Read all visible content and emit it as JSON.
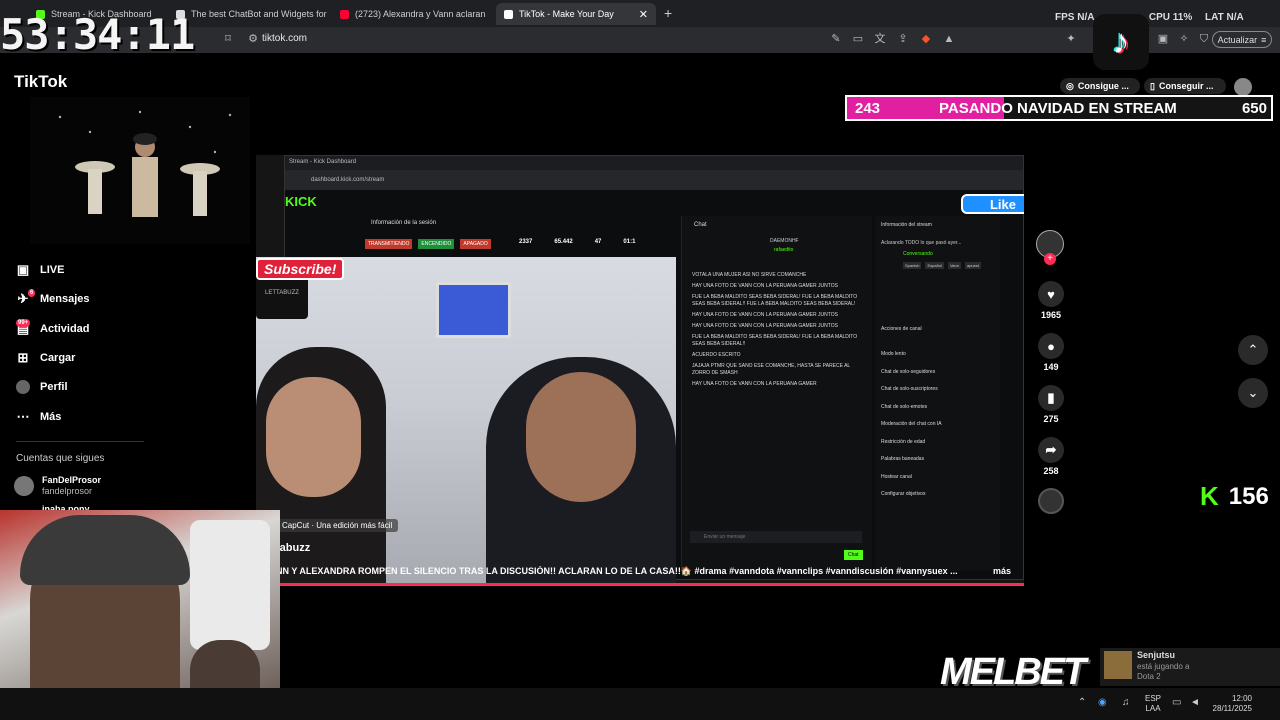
{
  "clock": "53:34:11",
  "tabs": [
    {
      "title": "Stream - Kick Dashboard",
      "color": "#53fc18"
    },
    {
      "title": "The best ChatBot and Widgets for Ki",
      "color": "#dddddd"
    },
    {
      "title": "(2723) Alexandra y Vann aclaran",
      "color": "#ff0033"
    },
    {
      "title": "TikTok - Make Your Day",
      "color": "#ffffff"
    }
  ],
  "address": {
    "url": "tiktok.com",
    "update_label": "Actualizar"
  },
  "system_stats": {
    "fps_label": "FPS",
    "fps_value": "N/A",
    "cpu_label": "CPU",
    "cpu_value": "11%",
    "lat_label": "LAT",
    "lat_value": "N/A"
  },
  "tiktok": {
    "logo": "TikTok",
    "nav": [
      {
        "label": "LIVE",
        "icon": "live-icon"
      },
      {
        "label": "Mensajes",
        "icon": "messages-icon",
        "badge": "6"
      },
      {
        "label": "Actividad",
        "icon": "activity-icon",
        "badge": "99+"
      },
      {
        "label": "Cargar",
        "icon": "upload-icon"
      },
      {
        "label": "Perfil",
        "icon": "profile-icon"
      },
      {
        "label": "Más",
        "icon": "more-icon"
      }
    ],
    "following_title": "Cuentas que sigues",
    "following": [
      {
        "name": "FanDelProsor",
        "handle": "fandelprosor"
      },
      {
        "name": "inaba.pony",
        "handle": ""
      }
    ],
    "header_buttons": [
      "Consigue ...",
      "Conseguir ..."
    ]
  },
  "video": {
    "capcut_label": "CapCut · Una edición más fácil",
    "author": "tabuzz",
    "caption": "NN Y ALEXANDRA ROMPEN EL SILENCIO TRAS LA DISCUSIÓN!! ACLARAN LO DE LA CASA!!🏠 #drama #vanndota #vannclips #vanndiscusión #vannysuex ...",
    "more": "más",
    "subscribe": "Subscribe!",
    "like": "Like",
    "streamer_tag": "LETTABUZZ"
  },
  "actions": {
    "likes": "1965",
    "comments": "149",
    "saves": "275",
    "shares": "258"
  },
  "goal": {
    "current": "243",
    "title": "PASANDO NAVIDAD EN STREAM",
    "target": "650",
    "progress": 0.37
  },
  "kick_viewers": "156",
  "kick_dashboard": {
    "tab_title": "Stream - Kick Dashboard",
    "url": "dashboard.kick.com/stream",
    "logo": "KICK",
    "session_title": "Información de la sesión",
    "chips": [
      "TRANSMITIENDO",
      "ENCENDIDO",
      "APAGADO"
    ],
    "session_stats": [
      "2337",
      "65.442",
      "47",
      "01:1"
    ],
    "chat_title": "Chat",
    "stream_info_title": "Información del stream",
    "stream_info_text": "Aclarando TODO lo que pasó ayer...",
    "stream_info_category": "Conversando",
    "stream_tags": [
      "Spanish",
      "Español",
      "Vann",
      "apuest"
    ],
    "channel_actions_title": "Acciones de canal",
    "channel_actions": [
      "Modo lento",
      "Chat de solo-seguidores",
      "Chat de solo-suscriptores",
      "Chat de solo-emotes",
      "Moderación del chat con IA",
      "Restricción de edad",
      "Palabras baneadas",
      "Hostear canal",
      "Configurar objetivos"
    ],
    "chat_messages": [
      "VOTALA UNA MUJER ASI NO SIRVE COMANCHE",
      "HAY UNA FOTO DE VANN CON LA PERUANA GAMER JUNTOS",
      "FUE LA BEBA MALDITO SEAS BEBA SIDERAL! FUE LA BEBA MALDITO SEAS BEBA SIDERAL!! FUE LA BEBA MALDITO SEAS BEBA SIDERAL!",
      "HAY UNA FOTO DE VANN CON LA PERUANA GAMER JUNTOS",
      "HAY UNA FOTO DE VANN CON LA PERUANA GAMER JUNTOS",
      "FUE LA BEBA MALDITO SEAS BEBA SIDERAL! FUE LA BEBA MALDITO SEAS BEBA SIDERAL!!",
      "ACUERDO ESCRITO",
      "JAJAJA PTMR QUE SANO ESE COMANCHE, HASTA SE PARECE AL ZORRO DE SMASH",
      "HAY UNA FOTO DE VANN CON LA PERUANA GAMER"
    ],
    "chat_input_placeholder": "Enviar un mensaje",
    "chat_button": "Chat",
    "daemon": "DAEMONHF",
    "rafaedito": "rafaedito"
  },
  "notification": {
    "name": "Senjutsu",
    "status": "está jugando a",
    "game": "Dota 2"
  },
  "melbet": "MELBET",
  "taskbar": {
    "lang": "ESP",
    "layout": "LAA",
    "time": "12:00",
    "date": "28/11/2025"
  }
}
